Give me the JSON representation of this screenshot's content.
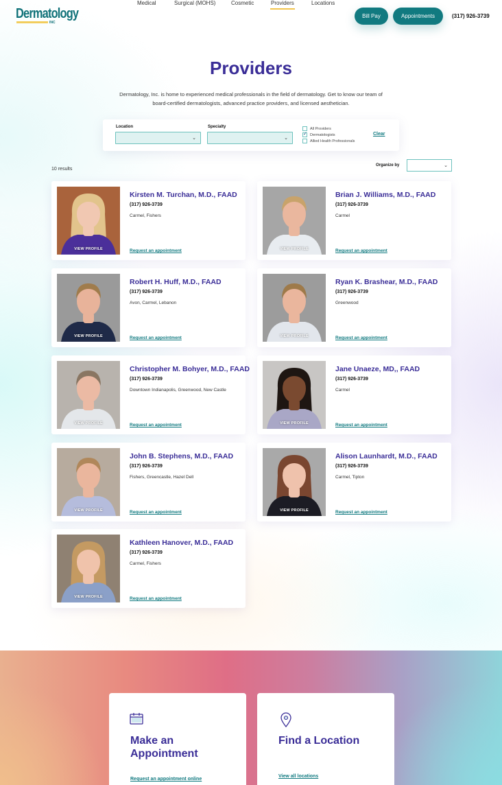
{
  "brand": {
    "logo_text": "Dermatology",
    "logo_suffix": "INC"
  },
  "nav": {
    "items": [
      {
        "label": "Medical",
        "active": false
      },
      {
        "label": "Surgical (MOHS)",
        "active": false
      },
      {
        "label": "Cosmetic",
        "active": false
      },
      {
        "label": "Providers",
        "active": true
      },
      {
        "label": "Locations",
        "active": false
      }
    ],
    "bill_pay_label": "Bill Pay",
    "appointments_label": "Appointments",
    "phone": "(317) 926-3739"
  },
  "hero": {
    "title": "Providers",
    "intro": "Dermatology, Inc. is home to experienced medical professionals in the field of dermatology. Get to know our team of board-certified dermatologists, advanced practice providers, and licensed aesthetician."
  },
  "filters": {
    "location_label": "Location",
    "location_value": "",
    "specialty_label": "Specialty",
    "specialty_value": "",
    "checkboxes": [
      {
        "label": "All Providers",
        "checked": false
      },
      {
        "label": "Dermatologists",
        "checked": true
      },
      {
        "label": "Allied Health Professionals",
        "checked": false
      }
    ],
    "clear_label": "Clear"
  },
  "results": {
    "count_text": "10 results",
    "organize_label": "Organize by",
    "organize_value": ""
  },
  "providers": [
    {
      "name": "Kirsten M. Turchan, M.D., FAAD",
      "phone": "(317) 926-3739",
      "locations": "Carmel, Fishers",
      "view_profile": "VIEW PROFILE",
      "appt_link": "Request an appointment",
      "photo": {
        "bg": "#a9633c",
        "skin": "#f1c8b2",
        "hair": "#e2c48c",
        "shirt": "#4b2f9a"
      }
    },
    {
      "name": "Brian J. Williams, M.D., FAAD",
      "phone": "(317) 926-3739",
      "locations": "Carmel",
      "view_profile": "VIEW PROFILE",
      "appt_link": "Request an appointment",
      "photo": {
        "bg": "#a6a6a6",
        "skin": "#eab79e",
        "hair": "#c8a36b",
        "shirt": "#e8ecf0"
      }
    },
    {
      "name": "Robert H. Huff, M.D., FAAD",
      "phone": "(317) 926-3739",
      "locations": "Avon, Carmel, Lebanon",
      "view_profile": "VIEW PROFILE",
      "appt_link": "Request an appointment",
      "photo": {
        "bg": "#9a9a9a",
        "skin": "#e8b39a",
        "hair": "#a07c4c",
        "shirt": "#1f2a48"
      }
    },
    {
      "name": "Ryan K. Brashear, M.D., FAAD",
      "phone": "(317) 926-3739",
      "locations": "Greenwood",
      "view_profile": "VIEW PROFILE",
      "appt_link": "Request an appointment",
      "photo": {
        "bg": "#9c9c9c",
        "skin": "#eab69d",
        "hair": "#9e7a4a",
        "shirt": "#e2e6ec"
      }
    },
    {
      "name": "Christopher M. Bohyer, M.D., FAAD",
      "phone": "(317) 926-3739",
      "locations": "Downtown Indianapolis, Greenwood, New Castle",
      "view_profile": "VIEW PROFILE",
      "appt_link": "Request an appointment",
      "photo": {
        "bg": "#b8b3ad",
        "skin": "#ebbaa4",
        "hair": "#8a7662",
        "shirt": "#e4e7ea"
      }
    },
    {
      "name": "Jane Unaeze, MD,, FAAD",
      "phone": "(317) 926-3739",
      "locations": "Carmel",
      "view_profile": "VIEW PROFILE",
      "appt_link": "Request an appointment",
      "photo": {
        "bg": "#c8c6c4",
        "skin": "#7a4a30",
        "hair": "#1e1612",
        "shirt": "#a9a7c6"
      }
    },
    {
      "name": "John B. Stephens, M.D., FAAD",
      "phone": "(317) 926-3739",
      "locations": "Fishers, Greencastle, Hazel Dell",
      "view_profile": "VIEW PROFILE",
      "appt_link": "Request an appointment",
      "photo": {
        "bg": "#b7ab9e",
        "skin": "#eab69d",
        "hair": "#b0875a",
        "shirt": "#b5bcdc"
      }
    },
    {
      "name": "Alison Launhardt, M.D., FAAD",
      "phone": "(317) 926-3739",
      "locations": "Carmel, Tipton",
      "view_profile": "VIEW PROFILE",
      "appt_link": "Request an appointment",
      "photo": {
        "bg": "#a9a9a9",
        "skin": "#efc2ac",
        "hair": "#7a4630",
        "shirt": "#1c1c24"
      }
    },
    {
      "name": "Kathleen Hanover, M.D., FAAD",
      "phone": "(317) 926-3739",
      "locations": "Carmel, Fishers",
      "view_profile": "VIEW PROFILE",
      "appt_link": "Request an appointment",
      "photo": {
        "bg": "#8f8172",
        "skin": "#f0c3ab",
        "hair": "#c49a62",
        "shirt": "#8ba0c8"
      }
    }
  ],
  "cta": {
    "appointment": {
      "icon": "calendar-icon",
      "title": "Make an Appointment",
      "link": "Request an appointment online"
    },
    "location": {
      "icon": "map-pin-icon",
      "title": "Find a Location",
      "link": "View all locations"
    }
  },
  "colors": {
    "brand_teal": "#117a80",
    "heading_purple": "#3a2d97",
    "nav_underline": "#f2c44c",
    "select_fill": "#dff2f1"
  }
}
